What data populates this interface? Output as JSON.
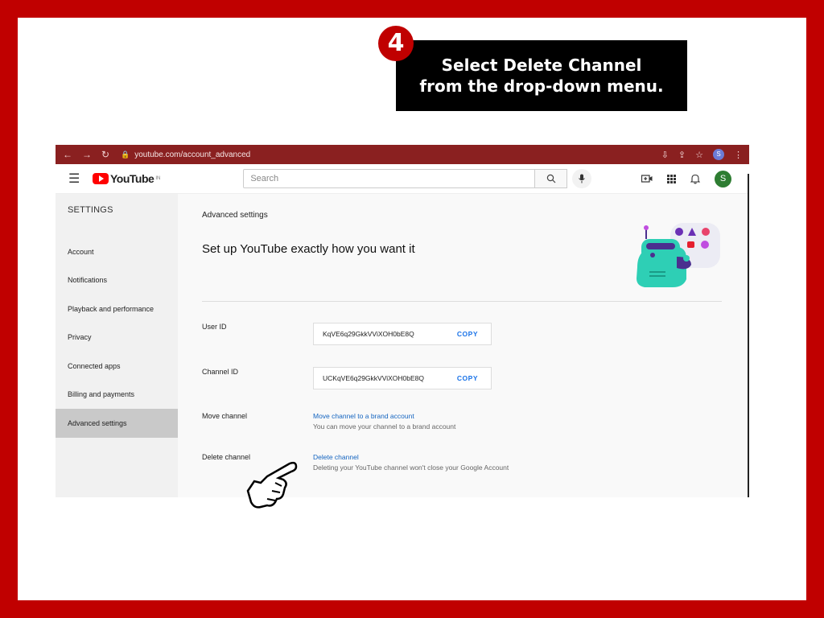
{
  "callout": {
    "step": "4",
    "line1": "Select Delete Channel",
    "line2": "from the drop-down menu."
  },
  "browser": {
    "url_host": "youtube.com",
    "url_path": "/account_advanced",
    "avatar": "S"
  },
  "youtube": {
    "logo_text": "YouTube",
    "logo_region": "IN",
    "search_placeholder": "Search",
    "avatar": "S"
  },
  "sidebar": {
    "header": "SETTINGS",
    "items": [
      {
        "label": "Account"
      },
      {
        "label": "Notifications"
      },
      {
        "label": "Playback and performance"
      },
      {
        "label": "Privacy"
      },
      {
        "label": "Connected apps"
      },
      {
        "label": "Billing and payments"
      },
      {
        "label": "Advanced settings",
        "active": true
      }
    ]
  },
  "main": {
    "section_title": "Advanced settings",
    "tagline": "Set up YouTube exactly how you want it",
    "user_id": {
      "label": "User ID",
      "value": "KqVE6q29GkkVViXOH0bE8Q",
      "copy": "COPY"
    },
    "channel_id": {
      "label": "Channel ID",
      "value": "UCKqVE6q29GkkVViXOH0bE8Q",
      "copy": "COPY"
    },
    "move_channel": {
      "label": "Move channel",
      "link": "Move channel to a brand account",
      "sub": "You can move your channel to a brand account"
    },
    "delete_channel": {
      "label": "Delete channel",
      "link": "Delete channel",
      "sub": "Deleting your YouTube channel won't close your Google Account"
    }
  },
  "colors": {
    "frame": "#c00000",
    "callout_bg": "#000000",
    "link": "#1565c0",
    "yt_red": "#ff0000"
  }
}
